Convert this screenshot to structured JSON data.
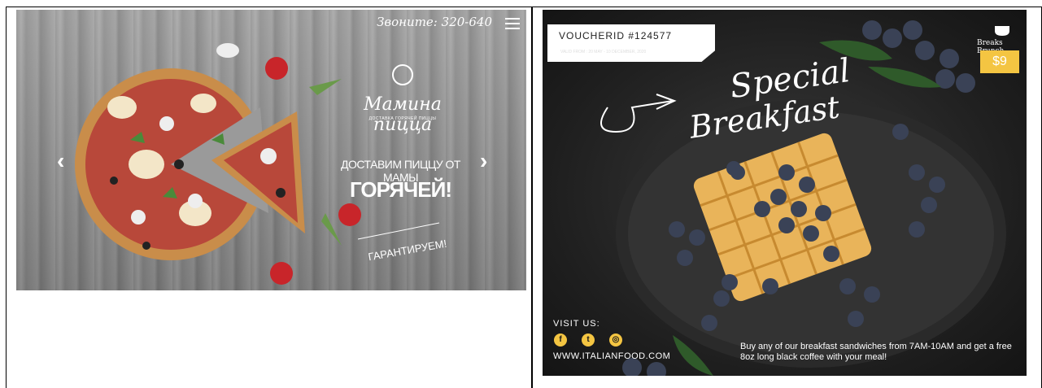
{
  "left_banner": {
    "phone_label": "Звоните:",
    "phone_number": "320-640",
    "brand_name": "Мамина пицца",
    "brand_sub": "ДОСТАВКА ГОРЯЧЕЙ ПИЦЦЫ",
    "tagline_1": "ДОСТАВИМ ПИЦЦУ ОТ МАМЫ",
    "tagline_2": "ГОРЯЧЕЙ!",
    "tagline_3": "ГАРАНТИРУЕМ!",
    "prev_arrow": "‹",
    "next_arrow": "›",
    "menu_icon": "hamburger-icon"
  },
  "right_poster": {
    "voucher_id": "VOUCHERID #124577",
    "valid_text": "VALID FROM : 20 MAY - 10 DECEMBER, 2020",
    "brand_label": "Breaks Brunch",
    "price": "$9",
    "title_line_1": "Special",
    "title_line_2": "Breakfast",
    "visit_label": "VISIT US:",
    "social": [
      "f",
      "t",
      "◎"
    ],
    "social_icons": [
      "facebook-icon",
      "twitter-icon",
      "instagram-icon"
    ],
    "website": "WWW.ITALIANFOOD.COM",
    "promo_text": "Buy any of our breakfast sandwiches from 7AM-10AM and get a free 8oz long black coffee with your meal!",
    "accent_color": "#f4c542"
  }
}
